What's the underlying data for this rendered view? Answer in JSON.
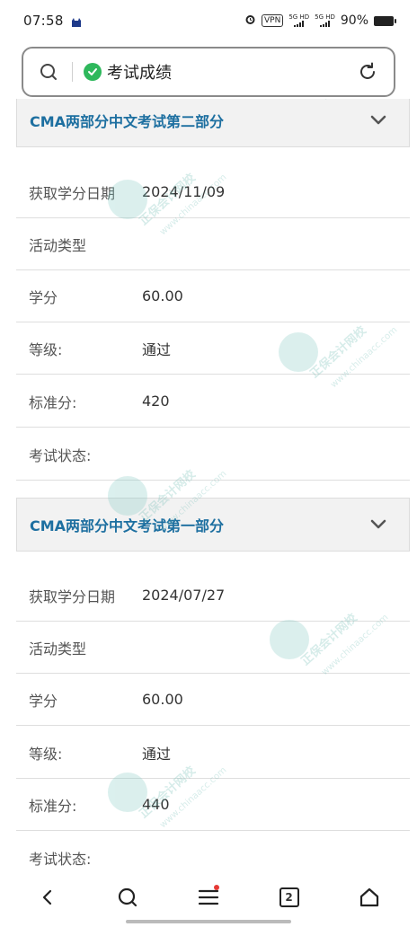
{
  "status_bar": {
    "time": "07:58",
    "vpn": "VPN",
    "net1": "5G HD",
    "net2": "5G HD",
    "battery": "90%"
  },
  "search": {
    "query": "考试成绩"
  },
  "sections": [
    {
      "title": "CMA两部分中文考试第二部分",
      "rows": [
        {
          "label": "获取学分日期",
          "value": "2024/11/09"
        },
        {
          "label": "活动类型",
          "value": ""
        },
        {
          "label": "学分",
          "value": "60.00"
        },
        {
          "label": "等级:",
          "value": "通过"
        },
        {
          "label": "标准分:",
          "value": "420"
        },
        {
          "label": "考试状态:",
          "value": ""
        }
      ]
    },
    {
      "title": "CMA两部分中文考试第一部分",
      "rows": [
        {
          "label": "获取学分日期",
          "value": "2024/07/27"
        },
        {
          "label": "活动类型",
          "value": ""
        },
        {
          "label": "学分",
          "value": "60.00"
        },
        {
          "label": "等级:",
          "value": "通过"
        },
        {
          "label": "标准分:",
          "value": "440"
        },
        {
          "label": "考试状态:",
          "value": ""
        }
      ]
    }
  ],
  "watermark": {
    "text": "正保会计网校",
    "url": "www.chinaacc.com"
  },
  "bottom_nav": {
    "tab_count": "2"
  }
}
